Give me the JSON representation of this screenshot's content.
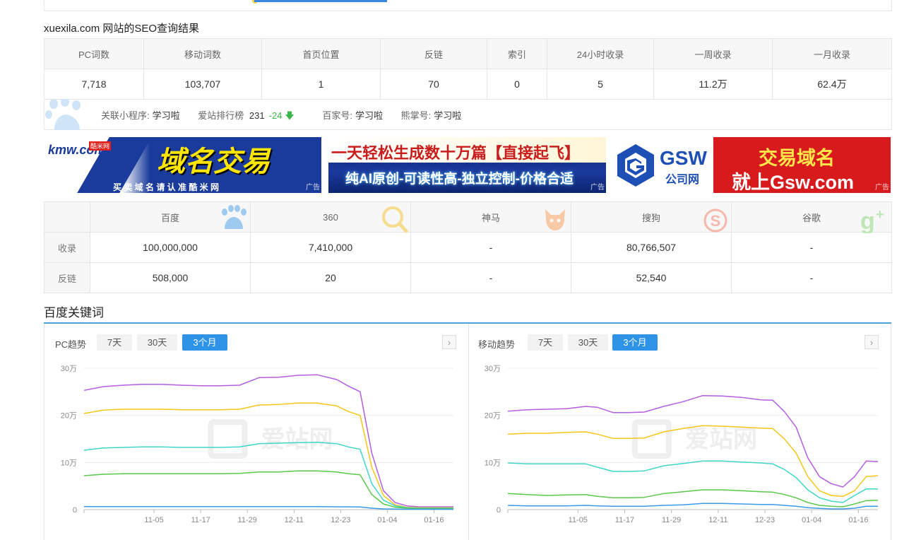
{
  "seo": {
    "title": "xuexila.com 网站的SEO查询结果",
    "headers": [
      "PC词数",
      "移动词数",
      "首页位置",
      "反链",
      "索引",
      "24小时收录",
      "一周收录",
      "一月收录"
    ],
    "values": [
      "7,718",
      "103,707",
      "1",
      "70",
      "0",
      "5",
      "11.2万",
      "62.4万"
    ]
  },
  "related": {
    "miniapp_label": "关联小程序:",
    "miniapp_value": "学习啦",
    "rank_label": "爱站排行榜",
    "rank_value": "231",
    "rank_change": "-24",
    "baijia_label": "百家号:",
    "baijia_value": "学习啦",
    "xiongzhang_label": "熊掌号:",
    "xiongzhang_value": "学习啦"
  },
  "banners": [
    {
      "brand": "kmw.com",
      "brand_cn": "酷米网",
      "headline": "域名交易",
      "sub": "买 卖 域 名 请 认 准 酷 米 网",
      "tag": "广告"
    },
    {
      "headline": "一天轻松生成数十万篇【直接起飞】",
      "sub": "纯AI原创-可读性高-独立控制-价格合适",
      "tag": "广告"
    },
    {
      "brand": "GSW",
      "brand_cn": "公司网",
      "headline": "交易域名",
      "sub": "就上Gsw.com",
      "tag": "广告"
    }
  ],
  "engines": {
    "headers": [
      "百度",
      "360",
      "神马",
      "搜狗",
      "谷歌"
    ],
    "rows": [
      {
        "label": "收录",
        "values": [
          "100,000,000",
          "7,410,000",
          "-",
          "80,766,507",
          "-"
        ]
      },
      {
        "label": "反链",
        "values": [
          "508,000",
          "20",
          "-",
          "52,540",
          "-"
        ]
      }
    ]
  },
  "keywords": {
    "title": "百度关键词",
    "tabs": [
      "7天",
      "30天",
      "3个月"
    ],
    "active_tab": "3个月",
    "watermark": "爱站网",
    "pc_title": "PC趋势",
    "mobile_title": "移动趋势"
  },
  "colors": {
    "purple": "#b45ee0",
    "yellow": "#f5c518",
    "teal": "#3fd6c8",
    "green": "#5ac94a",
    "blue": "#3a9ae8",
    "accent": "#2e93e6"
  },
  "chart_data": [
    {
      "type": "line",
      "title": "PC趋势",
      "ylim": [
        0,
        300000
      ],
      "yticks": [
        "0",
        "10万",
        "20万",
        "30万"
      ],
      "xticks": [
        "11-05",
        "11-17",
        "11-29",
        "12-11",
        "12-23",
        "01-04",
        "01-16"
      ],
      "grid": true,
      "x": [
        "10-18",
        "10-23",
        "10-28",
        "11-02",
        "11-07",
        "11-12",
        "11-17",
        "11-22",
        "11-27",
        "12-02",
        "12-07",
        "12-12",
        "12-17",
        "12-22",
        "12-25",
        "12-28",
        "12-31",
        "01-03",
        "01-06",
        "01-09",
        "01-12",
        "01-15",
        "01-18",
        "01-21"
      ],
      "series": [
        {
          "color": "purple",
          "values": [
            253000,
            261000,
            264000,
            266000,
            266000,
            264000,
            263000,
            263000,
            264000,
            280000,
            281000,
            285000,
            286000,
            276000,
            262000,
            250000,
            120000,
            40000,
            15000,
            8000,
            6000,
            6000,
            6000,
            6000
          ]
        },
        {
          "color": "yellow",
          "values": [
            204000,
            211000,
            213000,
            213000,
            213000,
            212000,
            212000,
            212000,
            213000,
            222000,
            223000,
            226000,
            226000,
            220000,
            208000,
            200000,
            90000,
            30000,
            10000,
            5000,
            4000,
            4000,
            4000,
            4000
          ]
        },
        {
          "color": "teal",
          "values": [
            126000,
            131000,
            132000,
            133000,
            133000,
            132000,
            132000,
            132000,
            133000,
            140000,
            141000,
            142000,
            143000,
            140000,
            133000,
            128000,
            55000,
            20000,
            8000,
            4000,
            3000,
            3000,
            3000,
            3000
          ]
        },
        {
          "color": "green",
          "values": [
            72000,
            75000,
            76000,
            76000,
            76000,
            76000,
            76000,
            76000,
            77000,
            80000,
            80000,
            82000,
            82000,
            80000,
            76000,
            74000,
            32000,
            12000,
            5000,
            3000,
            2000,
            2000,
            2000,
            2000
          ]
        },
        {
          "color": "blue",
          "values": [
            6500,
            6500,
            6500,
            6500,
            6500,
            6500,
            6500,
            6500,
            6500,
            6500,
            6500,
            6500,
            6500,
            6000,
            5800,
            5500,
            3000,
            1500,
            1000,
            800,
            800,
            800,
            800,
            800
          ]
        }
      ]
    },
    {
      "type": "line",
      "title": "移动趋势",
      "ylim": [
        0,
        300000
      ],
      "yticks": [
        "0",
        "10万",
        "20万",
        "30万"
      ],
      "xticks": [
        "11-05",
        "11-17",
        "11-29",
        "12-11",
        "12-23",
        "01-04",
        "01-16"
      ],
      "grid": true,
      "x": [
        "10-18",
        "10-23",
        "10-28",
        "11-02",
        "11-07",
        "11-10",
        "11-14",
        "11-18",
        "11-22",
        "11-27",
        "12-02",
        "12-07",
        "12-12",
        "12-17",
        "12-22",
        "12-25",
        "12-28",
        "12-31",
        "01-03",
        "01-06",
        "01-09",
        "01-12",
        "01-15",
        "01-18",
        "01-21"
      ],
      "series": [
        {
          "color": "purple",
          "values": [
            209000,
            212000,
            213000,
            214000,
            219000,
            217000,
            206000,
            206000,
            207000,
            219000,
            229000,
            242000,
            241000,
            238000,
            233000,
            232000,
            208000,
            175000,
            110000,
            70000,
            55000,
            48000,
            70000,
            103000,
            102000
          ]
        },
        {
          "color": "yellow",
          "values": [
            160000,
            162000,
            162000,
            164000,
            165000,
            160000,
            151000,
            151000,
            152000,
            165000,
            172000,
            178000,
            177000,
            175000,
            173000,
            172000,
            150000,
            120000,
            70000,
            40000,
            30000,
            28000,
            40000,
            70000,
            72000
          ]
        },
        {
          "color": "teal",
          "values": [
            99000,
            97000,
            97000,
            97000,
            97000,
            90000,
            81000,
            81000,
            82000,
            93000,
            98000,
            103000,
            103000,
            101000,
            99000,
            97000,
            85000,
            68000,
            42000,
            25000,
            18000,
            15000,
            30000,
            44000,
            44000
          ]
        },
        {
          "color": "green",
          "values": [
            34000,
            32000,
            30000,
            31000,
            32000,
            28000,
            25000,
            25000,
            26000,
            34000,
            38000,
            42000,
            42000,
            40000,
            38000,
            37000,
            32000,
            25000,
            15000,
            9000,
            7000,
            6000,
            12000,
            19000,
            20000
          ]
        },
        {
          "color": "blue",
          "values": [
            9000,
            8000,
            8000,
            8000,
            9000,
            8000,
            7000,
            7000,
            7000,
            9000,
            10000,
            13000,
            13000,
            12000,
            11000,
            11000,
            9000,
            7000,
            4000,
            2500,
            1500,
            1500,
            3000,
            7000,
            7000
          ]
        }
      ]
    }
  ]
}
